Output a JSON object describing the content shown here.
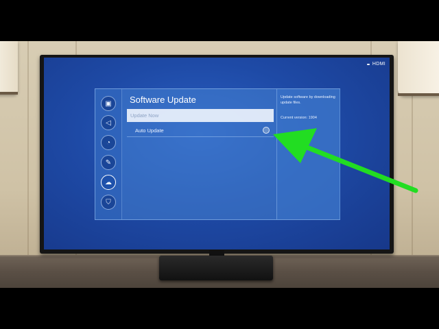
{
  "tv": {
    "input_badge": "",
    "input_label": "HDMI"
  },
  "menu": {
    "title": "Software Update",
    "sidebar_icons": [
      {
        "name": "picture-icon"
      },
      {
        "name": "sound-icon"
      },
      {
        "name": "broadcasting-icon"
      },
      {
        "name": "general-tools-icon"
      },
      {
        "name": "support-cloud-icon"
      },
      {
        "name": "privacy-shield-icon"
      }
    ],
    "active_sidebar_index": 4,
    "items": {
      "update_now": "Update Now",
      "auto_update": "Auto Update"
    },
    "auto_update_enabled": false,
    "info": {
      "description": "Update software by downloading update files.",
      "version": "Current version: 1904"
    }
  },
  "annotation": {
    "arrow_color": "#22dd22"
  }
}
